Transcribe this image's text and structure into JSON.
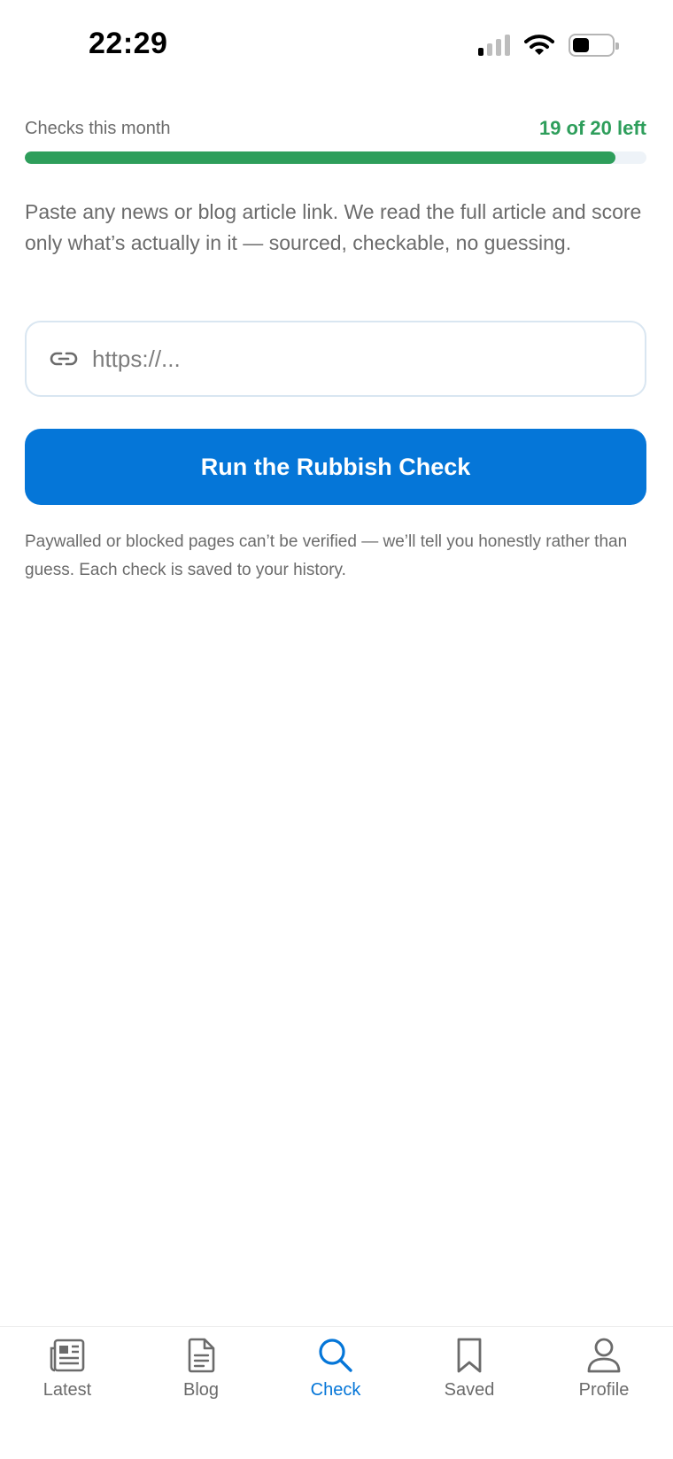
{
  "status_bar": {
    "time": "22:29"
  },
  "usage": {
    "label": "Checks this month",
    "count_text": "19 of 20 left",
    "progress_fraction": 0.95,
    "accent_color": "#2e9e5b"
  },
  "intro": "Paste any news or blog article link. We read the full article and score only what’s actually in it — sourced, checkable, no guessing.",
  "url_input": {
    "placeholder": "https://...",
    "value": "",
    "icon": "link-icon"
  },
  "run_button": {
    "label": "Run the Rubbish Check",
    "color": "#0576d8"
  },
  "footnote": "Paywalled or blocked pages can’t be verified — we’ll tell you honestly rather than guess. Each check is saved to your history.",
  "tab_bar": {
    "active": "Check",
    "items": [
      {
        "label": "Latest",
        "icon": "newspaper-icon"
      },
      {
        "label": "Blog",
        "icon": "document-icon"
      },
      {
        "label": "Check",
        "icon": "search-icon"
      },
      {
        "label": "Saved",
        "icon": "bookmark-icon"
      },
      {
        "label": "Profile",
        "icon": "person-icon"
      }
    ]
  }
}
